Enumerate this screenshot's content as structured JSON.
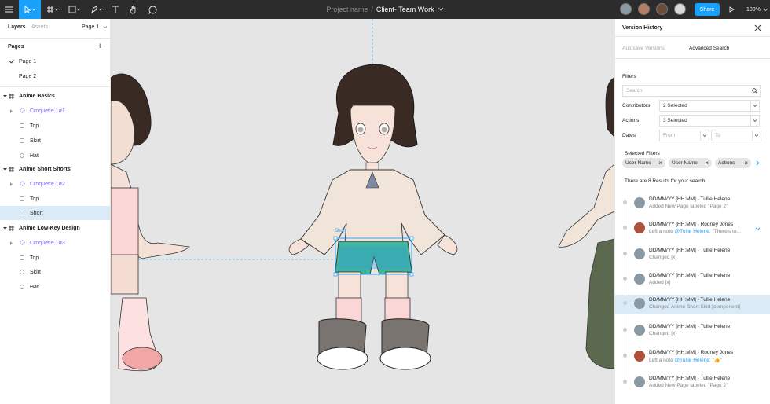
{
  "toolbar": {
    "icons": [
      "menu-icon",
      "move-tool-icon",
      "frame-tool-icon",
      "shape-tool-icon",
      "pen-tool-icon",
      "text-tool-icon",
      "hand-tool-icon",
      "comment-tool-icon"
    ],
    "project_name": "Project name",
    "separator": "/",
    "file_name": "Client- Team Work",
    "share_label": "Share",
    "zoom": "100%",
    "accent": "#18a0fb"
  },
  "left_panel": {
    "tab_layers": "Layers",
    "tab_assets": "Assets",
    "page_select": "Page 1",
    "pages_title": "Pages",
    "pages": [
      {
        "label": "Page 1",
        "current": true
      },
      {
        "label": "Page 2",
        "current": false
      }
    ],
    "sections": [
      {
        "label": "Anime Basics",
        "items": [
          {
            "label": "Croquette 1ø1",
            "type": "component"
          },
          {
            "label": "Top",
            "type": "frame"
          },
          {
            "label": "Skirt",
            "type": "frame"
          },
          {
            "label": "Hat",
            "type": "ellipse"
          }
        ]
      },
      {
        "label": "Anime Short Shorts",
        "items": [
          {
            "label": "Croquette 1ø2",
            "type": "component"
          },
          {
            "label": "Top",
            "type": "frame"
          },
          {
            "label": "Short",
            "type": "frame",
            "selected": true
          }
        ]
      },
      {
        "label": "Anime Low-Key Design",
        "items": [
          {
            "label": "Croquette 1ø3",
            "type": "component"
          },
          {
            "label": "Top",
            "type": "frame"
          },
          {
            "label": "Skirt",
            "type": "ellipse"
          },
          {
            "label": "Hat",
            "type": "ellipse"
          }
        ]
      }
    ]
  },
  "canvas": {
    "selection_label": "Short",
    "background": "#e5e5e5"
  },
  "right_panel": {
    "title": "Version History",
    "tab_autosave": "Autosave Versions",
    "tab_advanced": "Advanced Search",
    "filters_title": "Filters",
    "search_placeholder": "Search",
    "contributors_label": "Contributors",
    "contributors_value": "2 Selected",
    "actions_label": "Actions",
    "actions_value": "3 Selected",
    "dates_label": "Dates",
    "date_from": "From",
    "date_to": "To",
    "selected_filters_title": "Selected Filters",
    "chips": [
      "User Name",
      "User Name",
      "Actions"
    ],
    "results_text": "There are 8 Results for your search",
    "history": [
      {
        "title": "DD/MM/YY [HH:MM] - Tullie Helene",
        "detail": "Added New Page labeled \"Page 2\"",
        "selected": false
      },
      {
        "title": "DD/MM/YY [HH:MM] - Rodney Jones",
        "detail_prefix": "Left a note ",
        "mention": "@Tullie Helene:",
        "detail_suffix": " \"There's to...",
        "selected": false,
        "expandable": true
      },
      {
        "title": "DD/MM/YY [HH:MM] - Tullie Helene",
        "detail": "Changed [x]",
        "selected": false
      },
      {
        "title": "DD/MM/YY [HH:MM] - Tullie Helene",
        "detail": "Added [x]",
        "selected": false
      },
      {
        "title": "DD/MM/YY [HH:MM] - Tullie Helene",
        "detail": "Changed Anime Short Skirt [component]",
        "selected": true
      },
      {
        "title": "DD/MM/YY [HH:MM] - Tullie Helene",
        "detail": "Changed [x]",
        "selected": false
      },
      {
        "title": "DD/MM/YY [HH:MM] - Rodney Jones",
        "detail_prefix": "Left a note ",
        "mention": "@Tullie Helene:",
        "detail_suffix": " \"👍\"",
        "selected": false
      },
      {
        "title": "DD/MM/YY [HH:MM] - Tullie Helene",
        "detail": "Added New Page labeled \"Page 2\"",
        "selected": false
      }
    ]
  }
}
